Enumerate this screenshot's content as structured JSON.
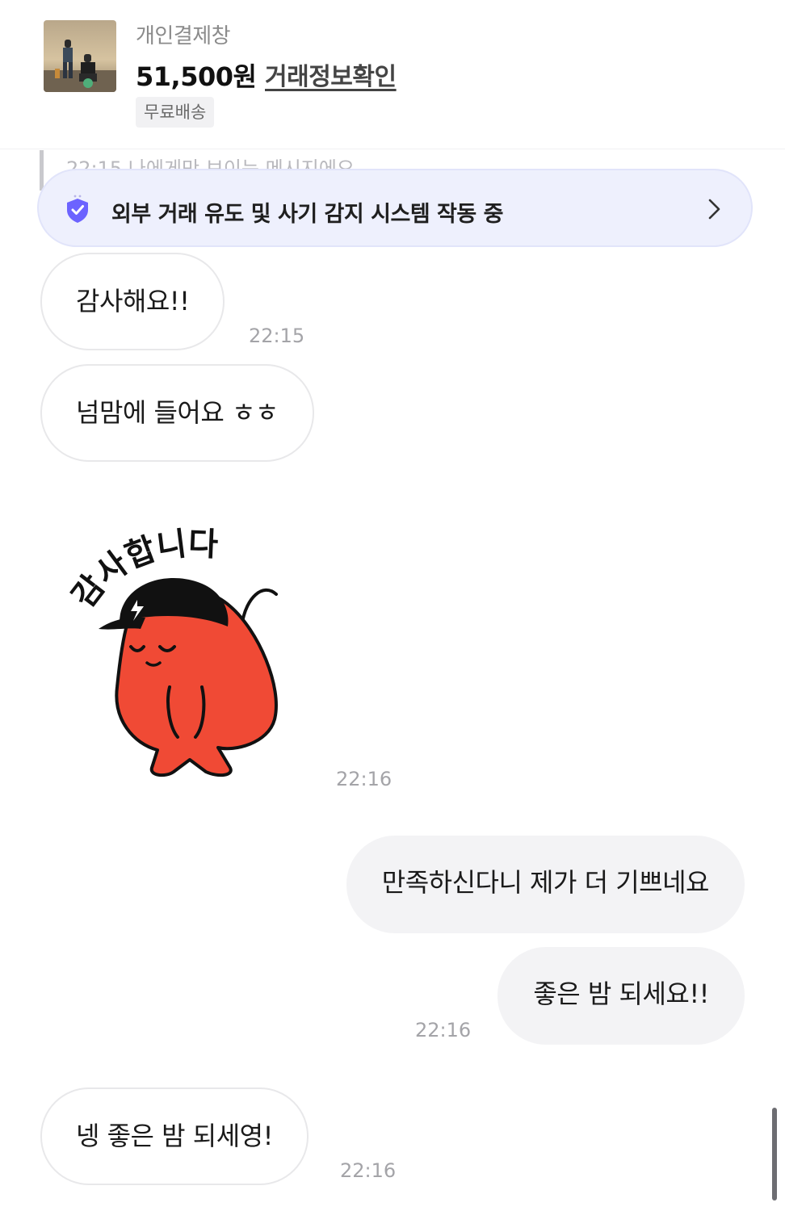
{
  "product": {
    "title": "개인결제창",
    "price": "51,500원",
    "trade_info_label": "거래정보확인",
    "shipping_badge": "무료배송"
  },
  "system_message": {
    "partial_text": "22:15 나에게만 보이는 메시지에요"
  },
  "fraud_banner": {
    "text": "외부 거래 유도 및 사기 감지 시스템 작동 중",
    "icon": "shield-check-icon"
  },
  "messages": [
    {
      "side": "in",
      "text": "감사해요!!",
      "time": "22:15"
    },
    {
      "side": "in",
      "text": "넘맘에 들어요 ㅎㅎ",
      "time": ""
    },
    {
      "side": "in",
      "type": "sticker",
      "sticker_text": "감사합니다",
      "time": "22:16"
    },
    {
      "side": "out",
      "text": "만족하신다니 제가 더 기쁘네요",
      "time": ""
    },
    {
      "side": "out",
      "text": "좋은 밤 되세요!!",
      "time": "22:16"
    },
    {
      "side": "in",
      "text": "넹 좋은 밤 되세영!",
      "time": "22:16"
    }
  ],
  "colors": {
    "banner_bg": "#eef0fd",
    "shield": "#6c63ff",
    "sticker_body": "#f04a35"
  }
}
